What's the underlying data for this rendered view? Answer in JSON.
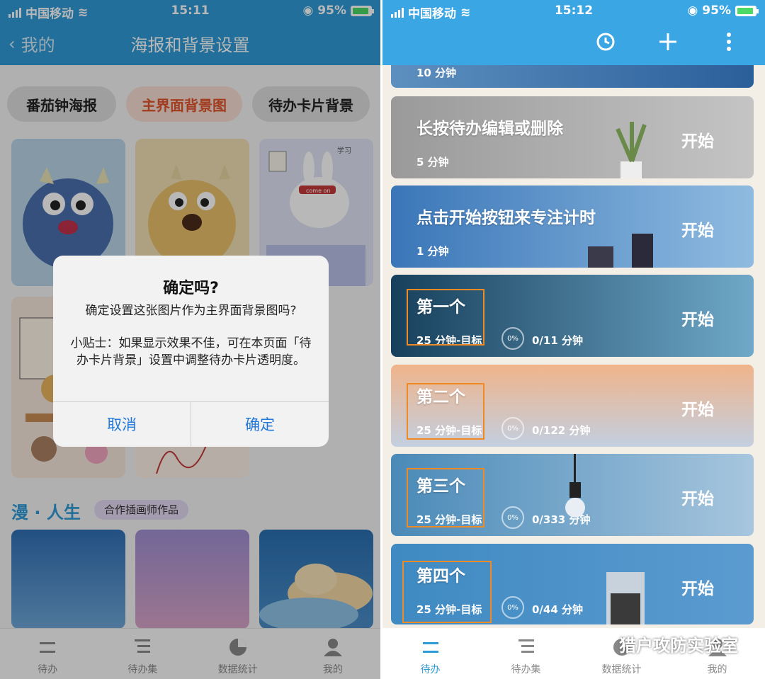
{
  "left": {
    "status": {
      "carrier": "中国移动",
      "time": "15:11",
      "battery": "95%"
    },
    "nav": {
      "back_label": "我的",
      "title": "海报和背景设置"
    },
    "filters": [
      "番茄钟海报",
      "主界面背景图",
      "待办卡片背景"
    ],
    "selected_filter": "主界面背景图",
    "thumb_texts": {
      "study": "学习",
      "come_on": "come on"
    },
    "section": {
      "title": "漫 · 人生",
      "badge": "合作插画师作品"
    },
    "dialog": {
      "title": "确定吗?",
      "message": "确定设置这张图片作为主界面背景图吗?",
      "tip": "小贴士：如果显示效果不佳，可在本页面「待办卡片背景」设置中调整待办卡片透明度。",
      "cancel": "取消",
      "confirm": "确定"
    },
    "tabs": [
      {
        "label": "待办"
      },
      {
        "label": "待办集"
      },
      {
        "label": "数据统计"
      },
      {
        "label": "我的"
      }
    ]
  },
  "right": {
    "status": {
      "carrier": "中国移动",
      "time": "15:12",
      "battery": "95%"
    },
    "cards": [
      {
        "meta": "10 分钟",
        "start": ""
      },
      {
        "title": "长按待办编辑或删除",
        "meta": "5 分钟",
        "start": "开始"
      },
      {
        "title": "点击开始按钮来专注计时",
        "meta": "1 分钟",
        "start": "开始"
      },
      {
        "title": "第一个",
        "meta": "25 分钟-目标",
        "progress": "0%",
        "ratio": "0/11 分钟",
        "start": "开始"
      },
      {
        "title": "第二个",
        "meta": "25 分钟-目标",
        "progress": "0%",
        "ratio": "0/122 分钟",
        "start": "开始"
      },
      {
        "title": "第三个",
        "meta": "25 分钟-目标",
        "progress": "0%",
        "ratio": "0/333 分钟",
        "start": "开始"
      },
      {
        "title": "第四个",
        "meta": "25 分钟-目标",
        "progress": "0%",
        "ratio": "0/44 分钟",
        "start": "开始"
      }
    ],
    "tabs": [
      {
        "label": "待办"
      },
      {
        "label": "待办集"
      },
      {
        "label": "数据统计"
      },
      {
        "label": "我的"
      }
    ],
    "active_tab": "待办",
    "watermark": "猎户攻防实验室"
  },
  "colors": {
    "accent": "#2e9ad6",
    "highlight": "#f08a24",
    "active_chip": "#e0552a"
  }
}
